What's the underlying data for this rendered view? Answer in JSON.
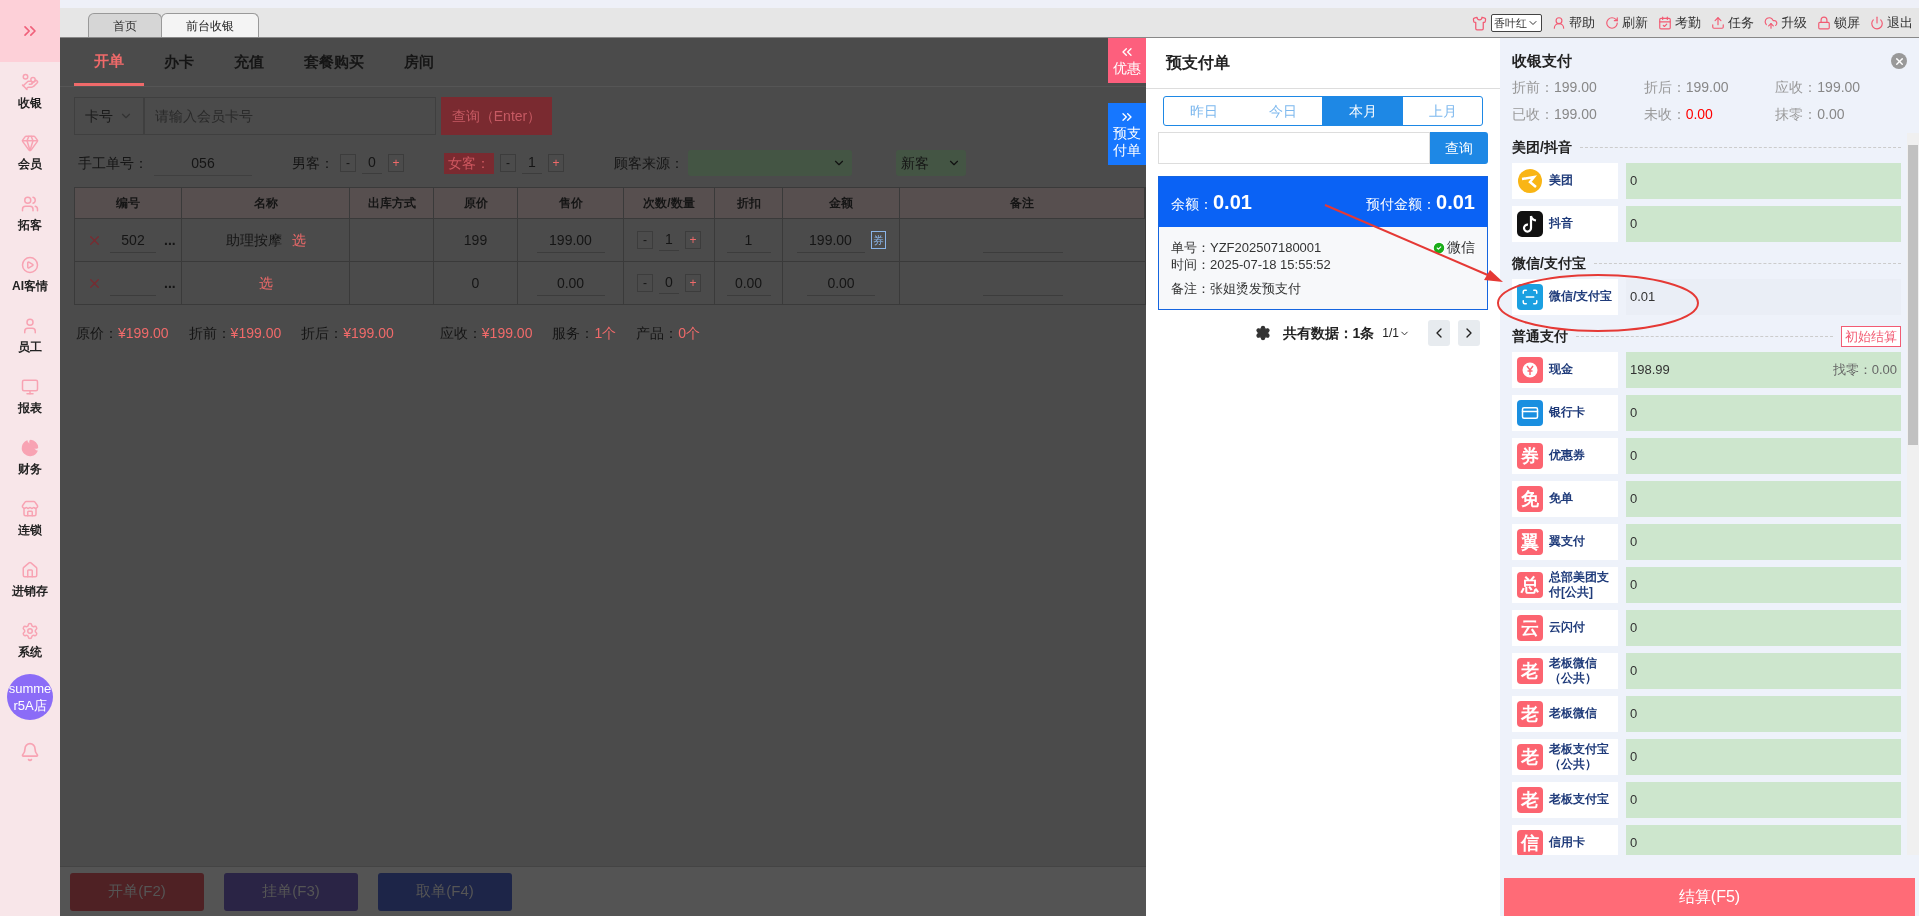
{
  "sidebar": {
    "items": [
      {
        "label": "收银"
      },
      {
        "label": "会员"
      },
      {
        "label": "拓客"
      },
      {
        "label": "AI客情"
      },
      {
        "label": "员工"
      },
      {
        "label": "报表"
      },
      {
        "label": "财务"
      },
      {
        "label": "连锁"
      },
      {
        "label": "进销存"
      },
      {
        "label": "系统"
      }
    ],
    "avatar": "summer5A店"
  },
  "tabs": [
    {
      "label": "首页",
      "selected": false
    },
    {
      "label": "前台收银",
      "selected": true
    }
  ],
  "toolbar": {
    "theme": "香叶红",
    "items": [
      {
        "label": "帮助"
      },
      {
        "label": "刷新"
      },
      {
        "label": "考勤"
      },
      {
        "label": "任务"
      },
      {
        "label": "升级"
      },
      {
        "label": "锁屏"
      },
      {
        "label": "退出"
      }
    ]
  },
  "subtabs": [
    {
      "label": "开单",
      "selected": true
    },
    {
      "label": "办卡",
      "selected": false
    },
    {
      "label": "充值",
      "selected": false
    },
    {
      "label": "套餐购买",
      "selected": false
    },
    {
      "label": "房间",
      "selected": false
    }
  ],
  "search": {
    "type": "卡号",
    "placeholder": "请输入会员卡号",
    "button": "查询（Enter）"
  },
  "form": {
    "manual_label": "手工单号：",
    "manual_value": "056",
    "counters": [
      {
        "label": "男客：",
        "highlighted": false,
        "minus": "-",
        "value": "0",
        "plus": "+"
      },
      {
        "label": "女客：",
        "highlighted": true,
        "minus": "-",
        "value": "1",
        "plus": "+"
      }
    ],
    "source_label": "顾客来源：",
    "customer_type": "新客"
  },
  "table": {
    "columns": [
      "编号",
      "名称",
      "出库方式",
      "原价",
      "售价",
      "次数/数量",
      "折扣",
      "金额",
      "备注"
    ],
    "rows": [
      {
        "code": "502",
        "more": "...",
        "name": "助理按摩",
        "pick": "选",
        "original": "199",
        "price": "199.00",
        "minus": "-",
        "qty": "1",
        "plus": "+",
        "discount": "1",
        "amount": "199.00",
        "coupon": "券"
      },
      {
        "more": "...",
        "pick": "选",
        "original": "0",
        "price": "0.00",
        "minus": "-",
        "qty": "0",
        "plus": "+",
        "discount": "0.00",
        "amount": "0.00"
      }
    ]
  },
  "summary": [
    {
      "label": "原价：",
      "value": "¥199.00"
    },
    {
      "label": "折前：",
      "value": "¥199.00"
    },
    {
      "label": "折后：",
      "value": "¥199.00"
    },
    {
      "label": "应收：",
      "value": "¥199.00"
    },
    {
      "label": "服务：",
      "value": "1个"
    },
    {
      "label": "产品：",
      "value": "0个"
    }
  ],
  "bottom_buttons": [
    {
      "label": "开单(F2)",
      "color": "#4f2124"
    },
    {
      "label": "挂单(F3)",
      "color": "#2a2445"
    },
    {
      "label": "取单(F4)",
      "color": "#1d2548"
    }
  ],
  "side_tabs": [
    {
      "label": "优惠",
      "color": "#fd5f7d"
    },
    {
      "label": "预支付单",
      "color": "#1677ff"
    }
  ],
  "prepay": {
    "title": "预支付单",
    "periods": [
      {
        "label": "昨日",
        "selected": false
      },
      {
        "label": "今日",
        "selected": false
      },
      {
        "label": "本月",
        "selected": true
      },
      {
        "label": "上月",
        "selected": false
      }
    ],
    "search_button": "查询",
    "card": {
      "balance_label": "余额：",
      "balance": "0.01",
      "prepaid_label": "预付金额：",
      "prepaid": "0.01",
      "order_label": "单号：",
      "order": "YZF202507180001",
      "method": "微信",
      "time_label": "时间：",
      "time": "2025-07-18 15:55:52",
      "note_label": "备注：",
      "note": "张姐烫发预支付"
    },
    "pager": {
      "total_label": "共有数据：",
      "total": "1条",
      "page": "1/1"
    }
  },
  "payment": {
    "title": "收银支付",
    "summary": [
      {
        "label": "折前：",
        "value": "199.00",
        "alert": false
      },
      {
        "label": "折后：",
        "value": "199.00",
        "alert": false
      },
      {
        "label": "应收：",
        "value": "199.00",
        "alert": false
      },
      {
        "label": "已收：",
        "value": "199.00",
        "alert": false
      },
      {
        "label": "未收：",
        "value": "0.00",
        "alert": true
      },
      {
        "label": "抹零：",
        "value": "0.00",
        "alert": false
      }
    ],
    "sections": [
      {
        "title": "美团/抖音",
        "methods": [
          {
            "kind": "meituan",
            "name": "美团",
            "value": "0",
            "highlighted": true
          },
          {
            "kind": "douyin",
            "name": "抖音",
            "value": "0",
            "highlighted": true
          }
        ]
      },
      {
        "title": "微信/支付宝",
        "methods": [
          {
            "kind": "scan",
            "name": "微信/支付宝",
            "value": "0.01",
            "highlighted": false
          }
        ]
      },
      {
        "title": "普通支付",
        "action": "初始结算",
        "methods": [
          {
            "kind": "cash",
            "name": "现金",
            "value": "198.99",
            "change": "找零：0.00",
            "highlighted": true
          },
          {
            "kind": "card",
            "name": "银行卡",
            "value": "0",
            "highlighted": true
          },
          {
            "kind": "glyph",
            "badge": "券",
            "name": "优惠券",
            "value": "0",
            "highlighted": true
          },
          {
            "kind": "glyph",
            "badge": "免",
            "name": "免单",
            "value": "0",
            "highlighted": true
          },
          {
            "kind": "glyph",
            "badge": "翼",
            "name": "翼支付",
            "value": "0",
            "highlighted": true
          },
          {
            "kind": "glyph",
            "badge": "总",
            "name": "总部美团支付[公共]",
            "value": "0",
            "highlighted": true
          },
          {
            "kind": "glyph",
            "badge": "云",
            "name": "云闪付",
            "value": "0",
            "highlighted": true
          },
          {
            "kind": "glyph",
            "badge": "老",
            "name": "老板微信（公共）",
            "value": "0",
            "highlighted": true
          },
          {
            "kind": "glyph",
            "badge": "老",
            "name": "老板微信",
            "value": "0",
            "highlighted": true
          },
          {
            "kind": "glyph",
            "badge": "老",
            "name": "老板支付宝（公共）",
            "value": "0",
            "highlighted": true
          },
          {
            "kind": "glyph",
            "badge": "老",
            "name": "老板支付宝",
            "value": "0",
            "highlighted": true
          },
          {
            "kind": "glyph",
            "badge": "信",
            "name": "信用卡",
            "value": "0",
            "highlighted": true
          }
        ]
      }
    ],
    "settle": "结算(F5)"
  }
}
